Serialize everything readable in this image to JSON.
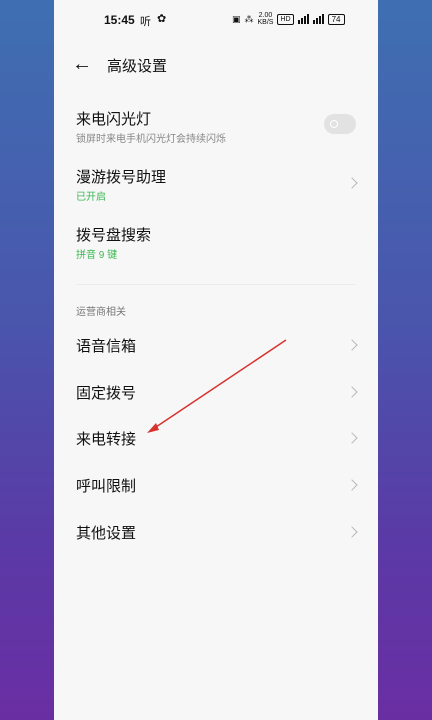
{
  "status_bar": {
    "time": "15:45",
    "carrier_glyph": "听",
    "chat_glyph": "✿",
    "speed_value": "2.00",
    "speed_unit": "KB/S",
    "network_chip": "HD",
    "battery": "74"
  },
  "header": {
    "title": "高级设置"
  },
  "settings": {
    "flash": {
      "title": "来电闪光灯",
      "subtitle": "锁屏时来电手机闪光灯会持续闪烁"
    },
    "roaming": {
      "title": "漫游拨号助理",
      "subtitle": "已开启"
    },
    "dial_search": {
      "title": "拨号盘搜索",
      "subtitle": "拼音 9 键"
    }
  },
  "carrier_section": {
    "heading": "运营商相关",
    "items": [
      "语音信箱",
      "固定拨号",
      "来电转接",
      "呼叫限制",
      "其他设置"
    ]
  },
  "colors": {
    "accent_green": "#3db854",
    "annotation_red": "#d6332f"
  }
}
